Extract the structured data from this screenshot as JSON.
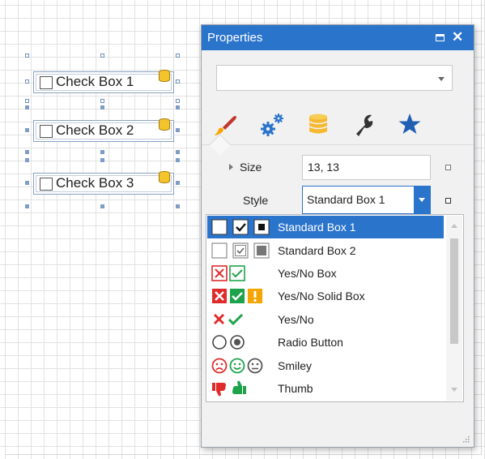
{
  "designer": {
    "check_boxes": [
      {
        "label": "Check Box 1"
      },
      {
        "label": "Check Box 2"
      },
      {
        "label": "Check Box 3"
      }
    ]
  },
  "panel": {
    "title": "Properties",
    "object_selector_value": "",
    "tabs": [
      {
        "name": "appearance",
        "icon": "paintbrush-icon",
        "selected": true
      },
      {
        "name": "behavior",
        "icon": "gears-icon",
        "selected": false
      },
      {
        "name": "data",
        "icon": "database-icon",
        "selected": false
      },
      {
        "name": "actions",
        "icon": "wrench-icon",
        "selected": false
      },
      {
        "name": "favorites",
        "icon": "star-icon",
        "selected": false
      }
    ],
    "properties": [
      {
        "label": "Size",
        "value": "13, 13"
      },
      {
        "label": "Style",
        "value": "Standard Box 1"
      }
    ]
  },
  "style_dropdown": {
    "selected_index": 0,
    "options": [
      {
        "label": "Standard Box 1",
        "icons": [
          "std1-unchecked-icon",
          "std1-checked-icon",
          "std1-indeterminate-icon"
        ]
      },
      {
        "label": "Standard Box 2",
        "icons": [
          "std2-unchecked-icon",
          "std2-checked-icon",
          "std2-indeterminate-icon"
        ]
      },
      {
        "label": "Yes/No Box",
        "icons": [
          "no-box-icon",
          "yes-box-icon"
        ]
      },
      {
        "label": "Yes/No Solid Box",
        "icons": [
          "no-solid-box-icon",
          "yes-solid-box-icon",
          "warning-solid-box-icon"
        ]
      },
      {
        "label": "Yes/No",
        "icons": [
          "no-cross-icon",
          "yes-check-icon"
        ]
      },
      {
        "label": "Radio Button",
        "icons": [
          "radio-empty-icon",
          "radio-filled-icon"
        ]
      },
      {
        "label": "Smiley",
        "icons": [
          "sad-face-icon",
          "happy-face-icon",
          "neutral-face-icon"
        ]
      },
      {
        "label": "Thumb",
        "icons": [
          "thumb-down-icon",
          "thumb-up-icon"
        ]
      }
    ]
  },
  "colors": {
    "accent": "#2b74cc",
    "red": "#e02b2b",
    "green": "#1ea34a",
    "orange": "#f5a500",
    "handle": "#7f9cc6"
  }
}
